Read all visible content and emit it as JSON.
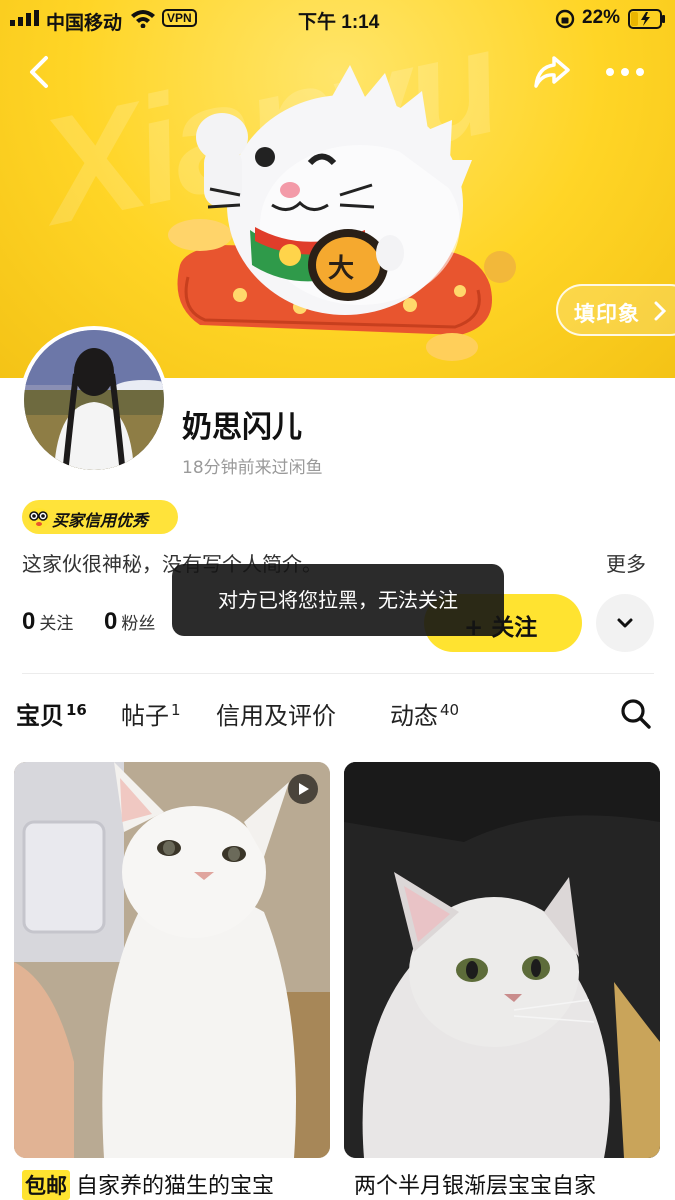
{
  "status_bar": {
    "carrier": "中国移动",
    "vpn": "VPN",
    "time": "下午 1:14",
    "battery": "22%"
  },
  "banner": {
    "impression_label": "填印象",
    "watermark": "Xianyu"
  },
  "profile": {
    "name": "奶思闪儿",
    "last_seen": "18分钟前来过闲鱼",
    "credit_badge": "买家信用优秀",
    "bio": "这家伙很神秘，没有写个人简介。",
    "more_label": "更多",
    "following_count": "0",
    "following_label": "关注",
    "fans_count": "0",
    "fans_label": "粉丝",
    "follow_button": "+ 关注"
  },
  "toast": "对方已将您拉黑，无法关注",
  "tabs": [
    {
      "label": "宝贝",
      "count": "16"
    },
    {
      "label": "帖子",
      "count": "1"
    },
    {
      "label": "信用及评价",
      "count": ""
    },
    {
      "label": "动态",
      "count": "40"
    }
  ],
  "items": [
    {
      "badge": "包邮",
      "title": "自家养的猫生的宝宝"
    },
    {
      "badge": "",
      "title": "两个半月银渐层宝宝自家"
    }
  ],
  "colors": {
    "accent": "#ffe330",
    "banner": "#ffd526",
    "toast_bg": "#141414"
  }
}
